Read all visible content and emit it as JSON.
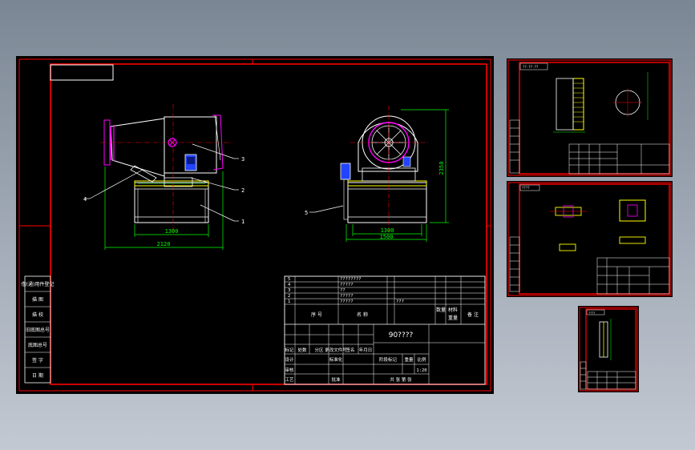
{
  "colors": {
    "background": "#000000",
    "frame": "#ff0000",
    "outline": "#ffffff",
    "dimension": "#00ff00",
    "centerline": "#ff0000",
    "accent": "#ff00ff",
    "motor": "#2244ff",
    "tank": "#ffff00",
    "text": "#ffffff"
  },
  "main_sheet": {
    "views": {
      "side": {
        "callouts": [
          "1",
          "2",
          "3",
          "4"
        ],
        "dims": {
          "inner_width": "1300",
          "overall_width": "2120"
        }
      },
      "front": {
        "callouts": [
          "5"
        ],
        "dims": {
          "inner_width": "1300",
          "overall_width": "1500",
          "height": "2350"
        }
      }
    },
    "title_block": {
      "bom": [
        {
          "no": "5",
          "desc": "????????"
        },
        {
          "no": "4",
          "desc": "?????"
        },
        {
          "no": "3",
          "desc": "??"
        },
        {
          "no": "2",
          "desc": "?????"
        },
        {
          "no": "1",
          "desc": "?????"
        }
      ],
      "bom_extra": "???",
      "header": {
        "seq": "序 号",
        "name": "名 称",
        "qty": "数量",
        "material": "材料",
        "weight": "重量",
        "remark": "备 注"
      },
      "drawing_title": "90????",
      "labels": {
        "revision": "标记",
        "count": "处数",
        "zone": "分区",
        "doc": "更改文件号",
        "sign": "签名",
        "date": "年月日",
        "design": "设计",
        "standard": "标准化",
        "stage": "阶段标记",
        "weight": "重量",
        "scale": "比例",
        "check": "审核",
        "process": "工艺",
        "approve": "批准",
        "sheets": "共 张 第 张"
      },
      "scale_value": "1:20"
    },
    "left_strip": [
      "借(通)用件登记",
      "描 图",
      "描 校",
      "旧底图总号",
      "底图总号",
      "签 字",
      "日 期"
    ]
  },
  "sub_sheets": [
    {
      "name": "sheet-part-1",
      "label": "??-??-??"
    },
    {
      "name": "sheet-part-2",
      "label": "????"
    },
    {
      "name": "sheet-part-3",
      "label": "????"
    }
  ]
}
